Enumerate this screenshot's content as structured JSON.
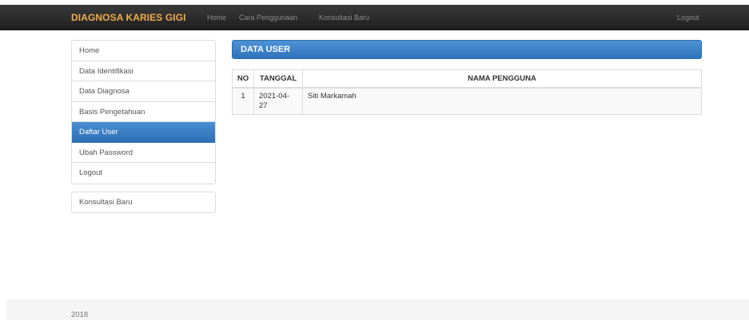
{
  "navbar": {
    "brand": "DIAGNOSA KARIES GIGI",
    "links": [
      "Home",
      "Cara Penggunaan",
      "Konsultasi Baru"
    ],
    "logout": "Logout"
  },
  "sidebar": {
    "items": [
      "Home",
      "Data Identifikasi",
      "Data Diagnosa",
      "Basis Pengetahuan",
      "Daftar User",
      "Ubah Password",
      "Logout"
    ],
    "active": "Daftar User",
    "secondary": "Konsultasi Baru"
  },
  "panel": {
    "title": "DATA USER"
  },
  "table": {
    "headers": [
      "NO",
      "TANGGAL",
      "NAMA PENGGUNA"
    ],
    "rows": [
      [
        "1",
        "2021-04-27",
        "Siti Markamah"
      ]
    ]
  },
  "footer": {
    "text": "2018"
  },
  "colors": {
    "brand": "#f0ad4e",
    "primary": "#337ab7",
    "navbar": "#222222"
  }
}
